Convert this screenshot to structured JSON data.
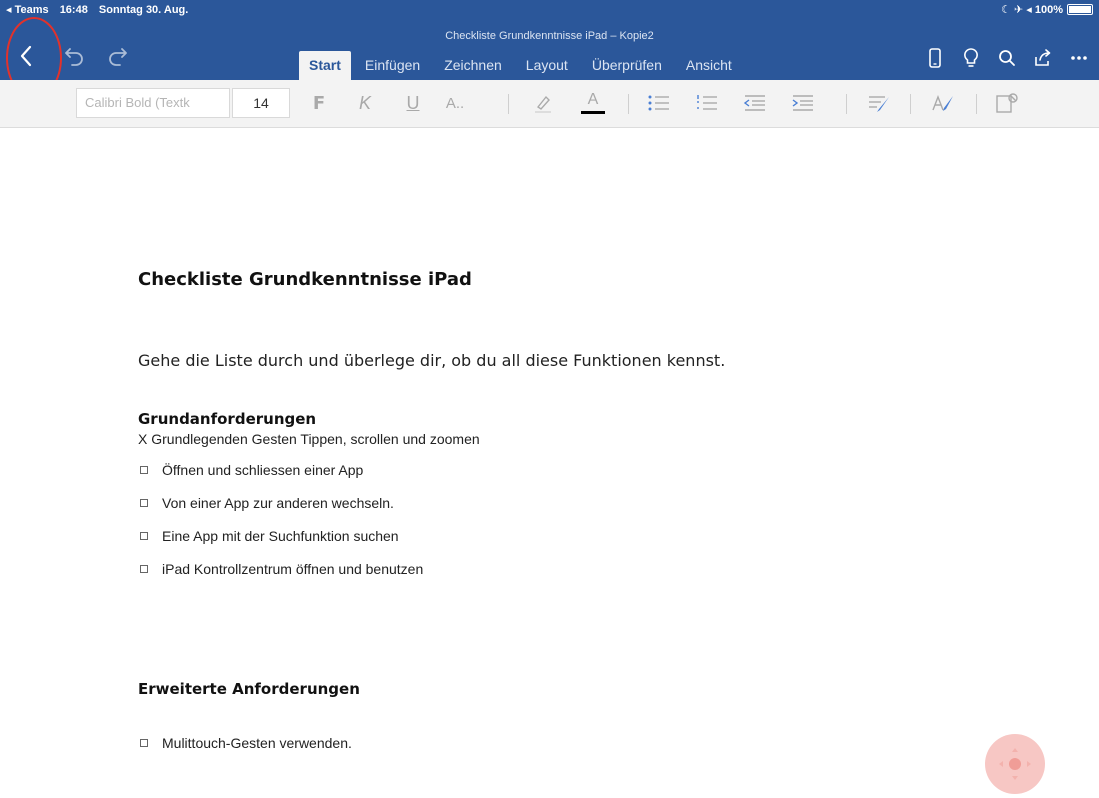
{
  "statusbar": {
    "back_app": "◂ Teams",
    "time": "16:48",
    "date": "Sonntag 30. Aug.",
    "indicators": "☾ ✈ ◂ 100%"
  },
  "header": {
    "document_title": "Checkliste Grundkenntnisse iPad – Kopie2",
    "tabs": [
      {
        "label": "Start",
        "active": true
      },
      {
        "label": "Einfügen"
      },
      {
        "label": "Zeichnen"
      },
      {
        "label": "Layout"
      },
      {
        "label": "Überprüfen"
      },
      {
        "label": "Ansicht"
      }
    ],
    "right_icons": [
      "phone-icon",
      "lightbulb-icon",
      "search-icon",
      "share-icon",
      "more-icon"
    ]
  },
  "toolbar": {
    "font_name": "Calibri Bold (Textk",
    "font_size": "14",
    "bold": "F",
    "italic": "K",
    "underline": "U",
    "font_style": "A..",
    "font_color": "A"
  },
  "document": {
    "title": "Checkliste Grundkenntnisse iPad",
    "intro": "Gehe die Liste durch und überlege dir, ob du all diese Funktionen kennst.",
    "section1": {
      "heading": "Grundanforderungen",
      "first_line": "X Grundlegenden Gesten Tippen, scrollen und zoomen",
      "items": [
        "Öffnen und schliessen einer App",
        "Von einer App zur anderen wechseln.",
        "Eine App mit der Suchfunktion suchen",
        "iPad Kontrollzentrum öffnen und benutzen"
      ]
    },
    "section2": {
      "heading": "Erweiterte Anforderungen",
      "items": [
        "Mulittouch-Gesten verwenden."
      ]
    }
  },
  "colors": {
    "ribbon": "#2b579a",
    "annotation_circle": "#e2322b"
  }
}
